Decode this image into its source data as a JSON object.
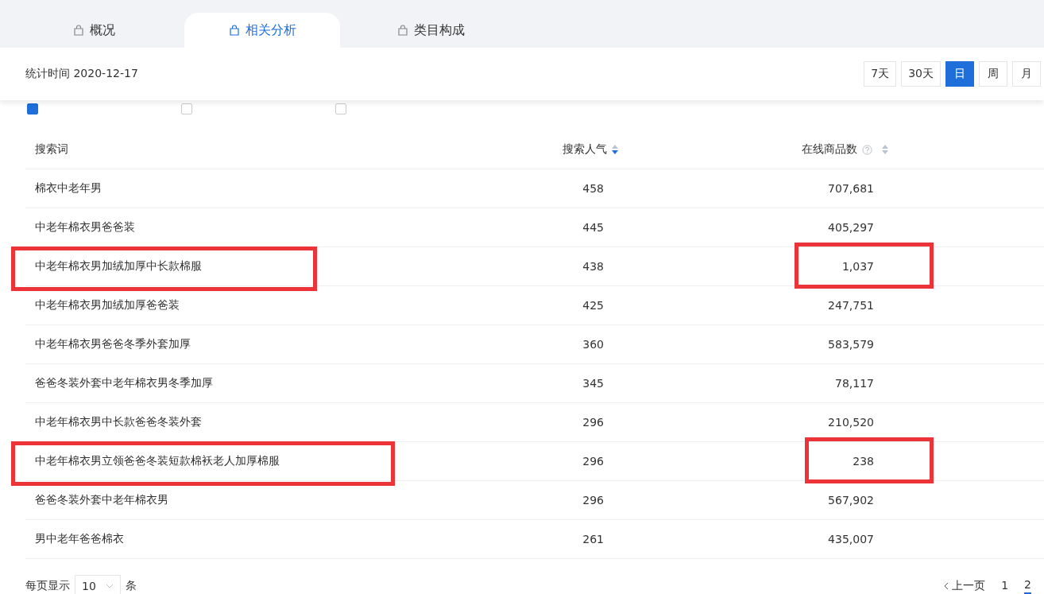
{
  "tabs": [
    {
      "label": "概况",
      "selected": false
    },
    {
      "label": "相关分析",
      "selected": true
    },
    {
      "label": "类目构成",
      "selected": false
    }
  ],
  "stat_time": "统计时间 2020-12-17",
  "period_buttons": [
    {
      "label": "7天",
      "selected": false
    },
    {
      "label": "30天",
      "selected": false
    },
    {
      "label": "日",
      "selected": true
    },
    {
      "label": "周",
      "selected": false
    },
    {
      "label": "月",
      "selected": false
    }
  ],
  "filters": [
    {
      "checked": true
    },
    {
      "checked": false
    },
    {
      "checked": false
    }
  ],
  "table": {
    "columns": [
      {
        "label": "搜索词"
      },
      {
        "label": "搜索人气",
        "sorted": true
      },
      {
        "label": "在线商品数",
        "sorted": false,
        "help": true
      }
    ],
    "rows": [
      {
        "keyword": "棉衣中老年男",
        "popularity": "458",
        "items": "707,681",
        "keyword_marked": false,
        "items_marked": false
      },
      {
        "keyword": "中老年棉衣男爸爸装",
        "popularity": "445",
        "items": "405,297",
        "keyword_marked": false,
        "items_marked": false
      },
      {
        "keyword": "中老年棉衣男加绒加厚中长款棉服",
        "popularity": "438",
        "items": "1,037",
        "keyword_marked": true,
        "items_marked": true
      },
      {
        "keyword": "中老年棉衣男加绒加厚爸爸装",
        "popularity": "425",
        "items": "247,751",
        "keyword_marked": false,
        "items_marked": false
      },
      {
        "keyword": "中老年棉衣男爸爸冬季外套加厚",
        "popularity": "360",
        "items": "583,579",
        "keyword_marked": false,
        "items_marked": false
      },
      {
        "keyword": "爸爸冬装外套中老年棉衣男冬季加厚",
        "popularity": "345",
        "items": "78,117",
        "keyword_marked": false,
        "items_marked": false
      },
      {
        "keyword": "中老年棉衣男中长款爸爸冬装外套",
        "popularity": "296",
        "items": "210,520",
        "keyword_marked": false,
        "items_marked": false
      },
      {
        "keyword": "中老年棉衣男立领爸爸冬装短款棉袄老人加厚棉服",
        "popularity": "296",
        "items": "238",
        "keyword_marked": true,
        "items_marked": true
      },
      {
        "keyword": "爸爸冬装外套中老年棉衣男",
        "popularity": "296",
        "items": "567,902",
        "keyword_marked": false,
        "items_marked": false
      },
      {
        "keyword": "男中老年爸爸棉衣",
        "popularity": "261",
        "items": "435,007",
        "keyword_marked": false,
        "items_marked": false
      }
    ]
  },
  "pagination": {
    "page_size_label": "每页显示",
    "page_size": "10",
    "page_size_unit": "条",
    "prev": "上一页",
    "pages": [
      {
        "label": "1",
        "selected": false
      },
      {
        "label": "2",
        "selected": true
      }
    ]
  }
}
